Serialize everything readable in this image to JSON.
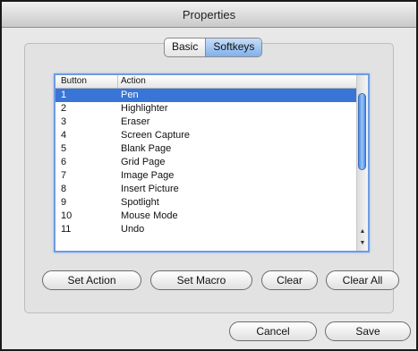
{
  "window": {
    "title": "Properties"
  },
  "tabs": [
    {
      "label": "Basic",
      "selected": false
    },
    {
      "label": "Softkeys",
      "selected": true
    }
  ],
  "table": {
    "columns": [
      "Button",
      "Action"
    ],
    "rows": [
      {
        "button": "1",
        "action": "Pen",
        "selected": true
      },
      {
        "button": "2",
        "action": "Highlighter"
      },
      {
        "button": "3",
        "action": "Eraser"
      },
      {
        "button": "4",
        "action": "Screen Capture"
      },
      {
        "button": "5",
        "action": "Blank Page"
      },
      {
        "button": "6",
        "action": "Grid Page"
      },
      {
        "button": "7",
        "action": "Image Page"
      },
      {
        "button": "8",
        "action": "Insert Picture"
      },
      {
        "button": "9",
        "action": "Spotlight"
      },
      {
        "button": "10",
        "action": "Mouse Mode"
      },
      {
        "button": "11",
        "action": "Undo"
      }
    ],
    "scrollbar": {
      "up_arrow": "▲",
      "down_arrow": "▼"
    }
  },
  "actions": {
    "set_action": "Set Action",
    "set_macro": "Set Macro",
    "clear": "Clear",
    "clear_all": "Clear All"
  },
  "footer": {
    "cancel": "Cancel",
    "save": "Save"
  },
  "colors": {
    "selection": "#3875d7",
    "focus_ring": "#6f9be0",
    "window_bg": "#e8e8e8"
  }
}
